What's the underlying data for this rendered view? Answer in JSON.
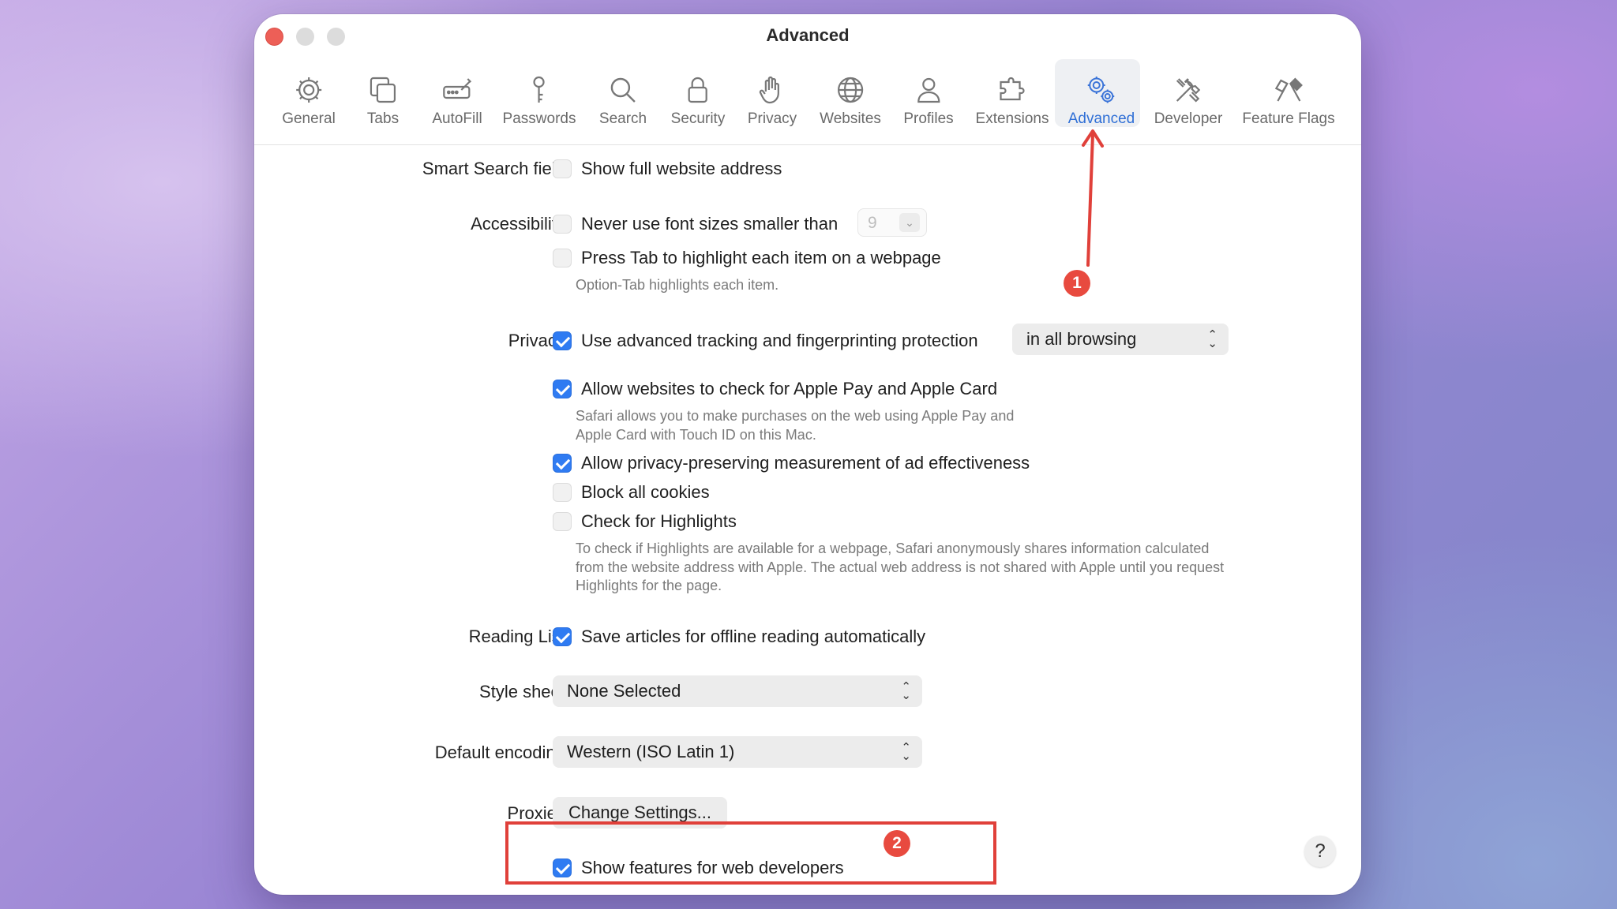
{
  "window": {
    "title": "Advanced"
  },
  "toolbar": {
    "items": [
      {
        "label": "General",
        "icon": "gear-icon"
      },
      {
        "label": "Tabs",
        "icon": "tabs-icon"
      },
      {
        "label": "AutoFill",
        "icon": "autofill-icon"
      },
      {
        "label": "Passwords",
        "icon": "key-icon"
      },
      {
        "label": "Search",
        "icon": "search-icon"
      },
      {
        "label": "Security",
        "icon": "lock-icon"
      },
      {
        "label": "Privacy",
        "icon": "hand-icon"
      },
      {
        "label": "Websites",
        "icon": "globe-icon"
      },
      {
        "label": "Profiles",
        "icon": "person-icon"
      },
      {
        "label": "Extensions",
        "icon": "puzzle-icon"
      },
      {
        "label": "Advanced",
        "icon": "gears-icon",
        "active": true
      },
      {
        "label": "Developer",
        "icon": "tools-icon"
      },
      {
        "label": "Feature Flags",
        "icon": "flags-icon"
      }
    ]
  },
  "settings": {
    "smart_search": {
      "label": "Smart Search field:",
      "option": "Show full website address",
      "checked": false
    },
    "accessibility": {
      "label": "Accessibility:",
      "font_option": "Never use font sizes smaller than",
      "font_size": "9",
      "tab_option": "Press Tab to highlight each item on a webpage",
      "tab_note": "Option-Tab highlights each item."
    },
    "privacy": {
      "label": "Privacy:",
      "tracking": "Use advanced tracking and fingerprinting protection",
      "tracking_mode": "in all browsing",
      "apple_pay": "Allow websites to check for Apple Pay and Apple Card",
      "apple_pay_note": "Safari allows you to make purchases on the web using Apple Pay and Apple Card with Touch ID on this Mac.",
      "ad_measurement": "Allow privacy-preserving measurement of ad effectiveness",
      "block_cookies": "Block all cookies",
      "highlights": "Check for Highlights",
      "highlights_note": "To check if Highlights are available for a webpage, Safari anonymously shares information calculated from the website address with Apple. The actual web address is not shared with Apple until you request Highlights for the page."
    },
    "reading_list": {
      "label": "Reading List:",
      "option": "Save articles for offline reading automatically"
    },
    "style_sheet": {
      "label": "Style sheet:",
      "value": "None Selected"
    },
    "encoding": {
      "label": "Default encoding:",
      "value": "Western (ISO Latin 1)"
    },
    "proxies": {
      "label": "Proxies:",
      "button": "Change Settings..."
    },
    "developer": {
      "option": "Show features for web developers"
    }
  },
  "annotations": {
    "badge1": "1",
    "badge2": "2",
    "color": "#e0403a"
  },
  "help": "?"
}
